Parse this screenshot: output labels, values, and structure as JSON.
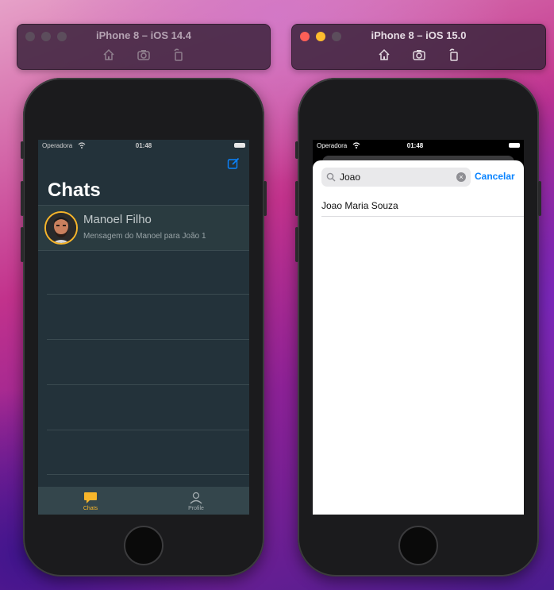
{
  "colors": {
    "accent_yellow": "#f7b52a",
    "link_blue": "#0a84ff",
    "left_app_bg": "#23323a",
    "close": "#ff5f57",
    "minimize": "#febc2e",
    "zoom": "#28c840",
    "inactive_light": "#5c4d5c"
  },
  "left_sim": {
    "title": "iPhone 8 – iOS 14.4",
    "tools": [
      "home-icon",
      "screenshot-icon",
      "rotate-icon"
    ],
    "app": {
      "carrier": "Operadora",
      "time": "01:48",
      "title": "Chats",
      "chats": [
        {
          "name": "Manoel Filho",
          "message": "Mensagem do Manoel para João 1"
        }
      ],
      "tabs": [
        {
          "label": "Chats",
          "icon": "chat-bubble-icon",
          "selected": true
        },
        {
          "label": "Profile",
          "icon": "person-icon",
          "selected": false
        }
      ]
    }
  },
  "right_sim": {
    "title": "iPhone 8 – iOS 15.0",
    "tools": [
      "home-icon",
      "screenshot-icon",
      "rotate-icon"
    ],
    "app": {
      "carrier": "Operadora",
      "time": "01:48",
      "search_value": "Joao",
      "cancel_label": "Cancelar",
      "results": [
        "Joao Maria Souza"
      ]
    }
  }
}
